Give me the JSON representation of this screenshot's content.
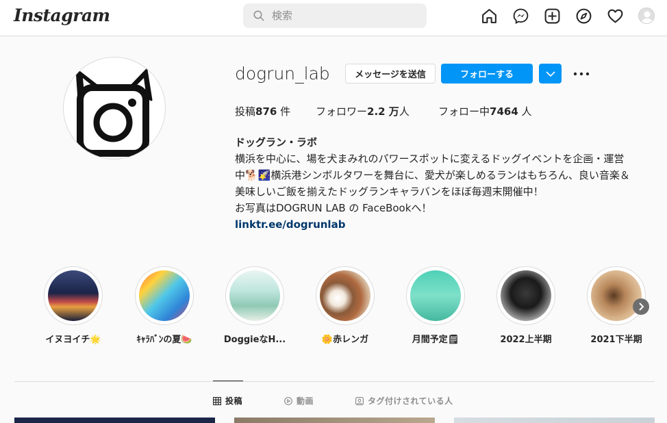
{
  "nav": {
    "logo": "Instagram",
    "search_placeholder": "検索",
    "icons": [
      "home-icon",
      "messenger-icon",
      "new-post-icon",
      "explore-icon",
      "activity-heart-icon",
      "profile-avatar"
    ]
  },
  "profile": {
    "username": "dogrun_lab",
    "message_button": "メッセージを送信",
    "follow_button": "フォローする",
    "stats": {
      "posts_prefix": "投稿",
      "posts_value": "876",
      "posts_suffix": " 件",
      "followers_prefix": "フォロワー",
      "followers_value": "2.2 万",
      "followers_suffix": "人",
      "following_prefix": "フォロー中",
      "following_value": "7464",
      "following_suffix": " 人"
    },
    "display_name": "ドッグラン・ラボ",
    "bio_lines": [
      "横浜を中心に、場を犬まみれのパワースポットに変えるドッグイベントを企画・運営",
      "中🐕🌠横浜港シンボルタワーを舞台に、愛犬が楽しめるランはもちろん、良い音楽＆",
      "美味しいご飯を揃えたドッグランキャラバンをほぼ毎週末開催中！",
      "お写真はDOGRUN LAB の FaceBookへ！"
    ],
    "link": "linktr.ee/dogrunlab"
  },
  "highlights": [
    {
      "label": "イヌヨイチ🌟"
    },
    {
      "label": "ｷｬﾗﾊﾞﾝの夏🍉"
    },
    {
      "label": "DoggieなH..."
    },
    {
      "label": "🌼赤レンガ"
    },
    {
      "label": "月間予定🗒"
    },
    {
      "label": "2022上半期"
    },
    {
      "label": "2021下半期"
    }
  ],
  "tabs": [
    {
      "label": "投稿"
    },
    {
      "label": "動画"
    },
    {
      "label": "タグ付けされている人"
    }
  ],
  "colors": {
    "accent": "#0095f6",
    "link": "#00376b",
    "border": "#dbdbdb",
    "text": "#262626",
    "muted": "#8e8e8e"
  }
}
